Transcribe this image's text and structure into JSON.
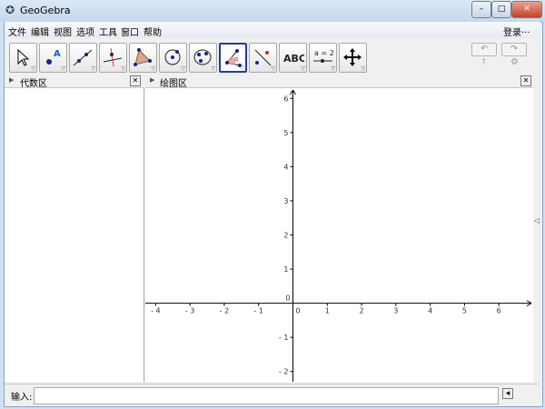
{
  "window": {
    "title": "GeoGebra",
    "controls": [
      "minimize",
      "maximize",
      "close"
    ]
  },
  "menu": {
    "items": [
      "文件",
      "编辑",
      "视图",
      "选项",
      "工具",
      "窗口",
      "帮助"
    ],
    "login": "登录···"
  },
  "toolbar": {
    "tools": [
      "move-tool",
      "point-tool",
      "line-tool",
      "perpendicular-line-tool",
      "polygon-tool",
      "circle-center-point-tool",
      "conic-five-points-tool",
      "angle-tool",
      "reflect-tool",
      "text-tool",
      "slider-tool",
      "move-graphics-view-tool"
    ],
    "selected_index": 7,
    "text_label": "ABC",
    "slider_label": "a = 2",
    "help": "?"
  },
  "panels": {
    "algebra_title": "代数区",
    "graphics_title": "绘图区"
  },
  "chart_data": {
    "type": "axes",
    "xlim": [
      -4.3,
      7.0
    ],
    "ylim": [
      -2.3,
      6.3
    ],
    "x_ticks": [
      -4,
      -3,
      -2,
      -1,
      0,
      1,
      2,
      3,
      4,
      5,
      6
    ],
    "y_ticks": [
      -2,
      -1,
      1,
      2,
      3,
      4,
      5,
      6
    ],
    "grid": false
  },
  "input": {
    "label": "输入:",
    "value": ""
  }
}
